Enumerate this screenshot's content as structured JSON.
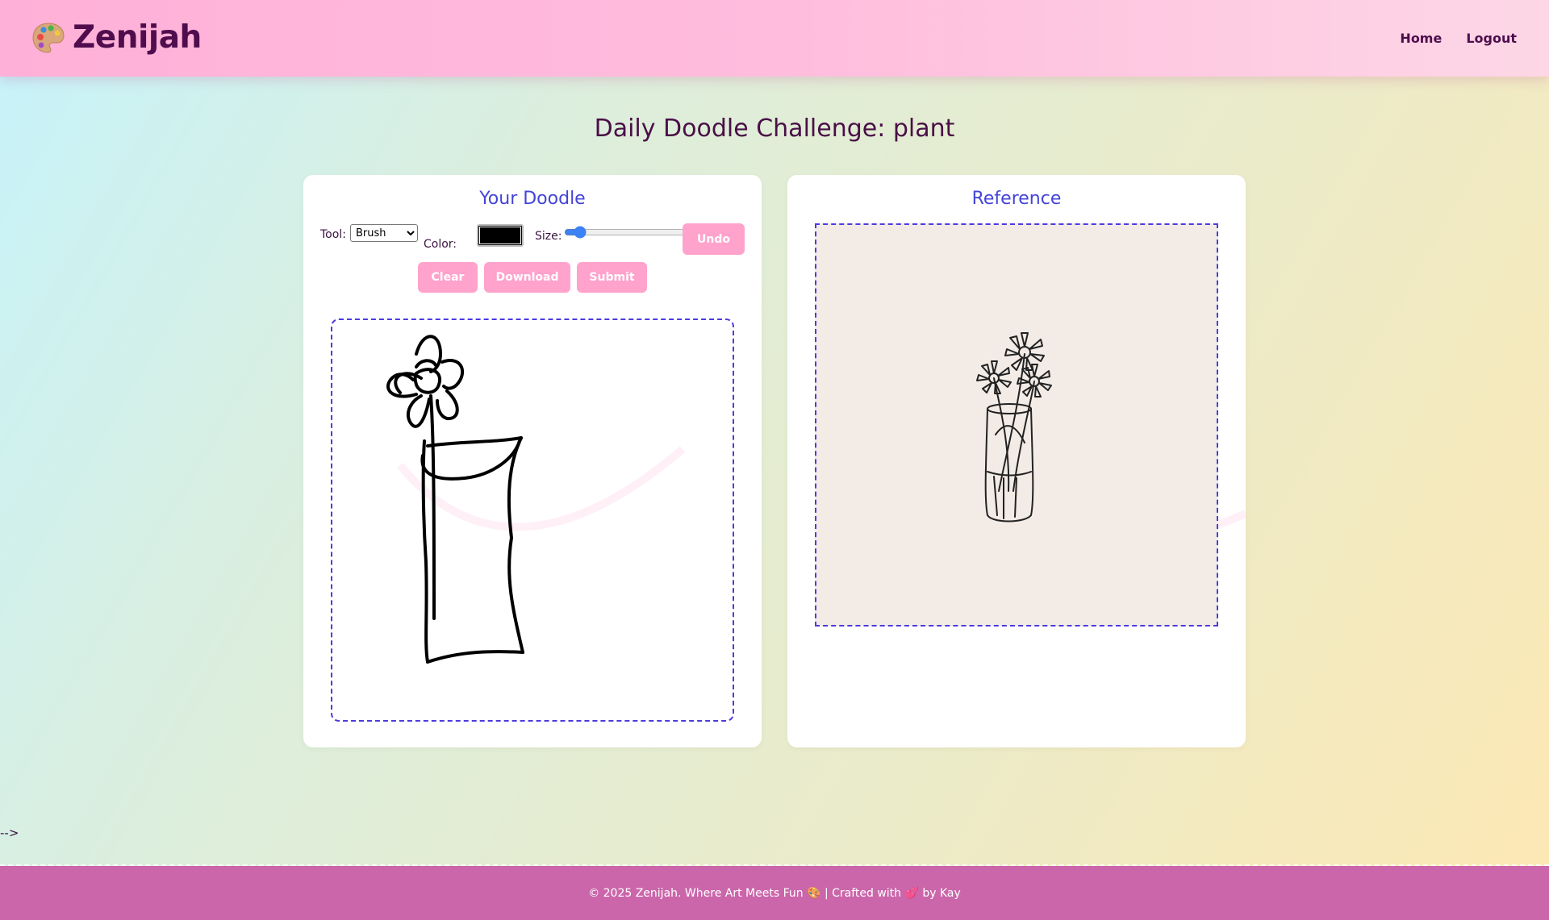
{
  "header": {
    "logo_text": "Zenijah",
    "nav": [
      {
        "label": "Home"
      },
      {
        "label": "Logout"
      }
    ]
  },
  "page_title": "Daily Doodle Challenge: plant",
  "doodle": {
    "title": "Your Doodle",
    "tool_label": "Tool:",
    "tool_options": [
      "Brush"
    ],
    "tool_selected": "Brush",
    "color_label": "Color:",
    "color_value": "#000000",
    "size_label": "Size:",
    "size_value": 5,
    "undo_label": "Undo",
    "clear_label": "Clear",
    "download_label": "Download",
    "submit_label": "Submit"
  },
  "reference": {
    "title": "Reference"
  },
  "stray_text": "-->",
  "footer": {
    "text": "© 2025 Zenijah. Where Art Meets Fun 🎨 | Crafted with 💕 by Kay"
  },
  "colors": {
    "header_start": "#ffb0d8",
    "header_end": "#fdd7e6",
    "brand_text": "#4f0d4d",
    "card_title": "#4444d8",
    "dashed_border": "#4d3be0",
    "button_pink": "#ffa2cc",
    "footer_bg": "#cb66aa"
  }
}
